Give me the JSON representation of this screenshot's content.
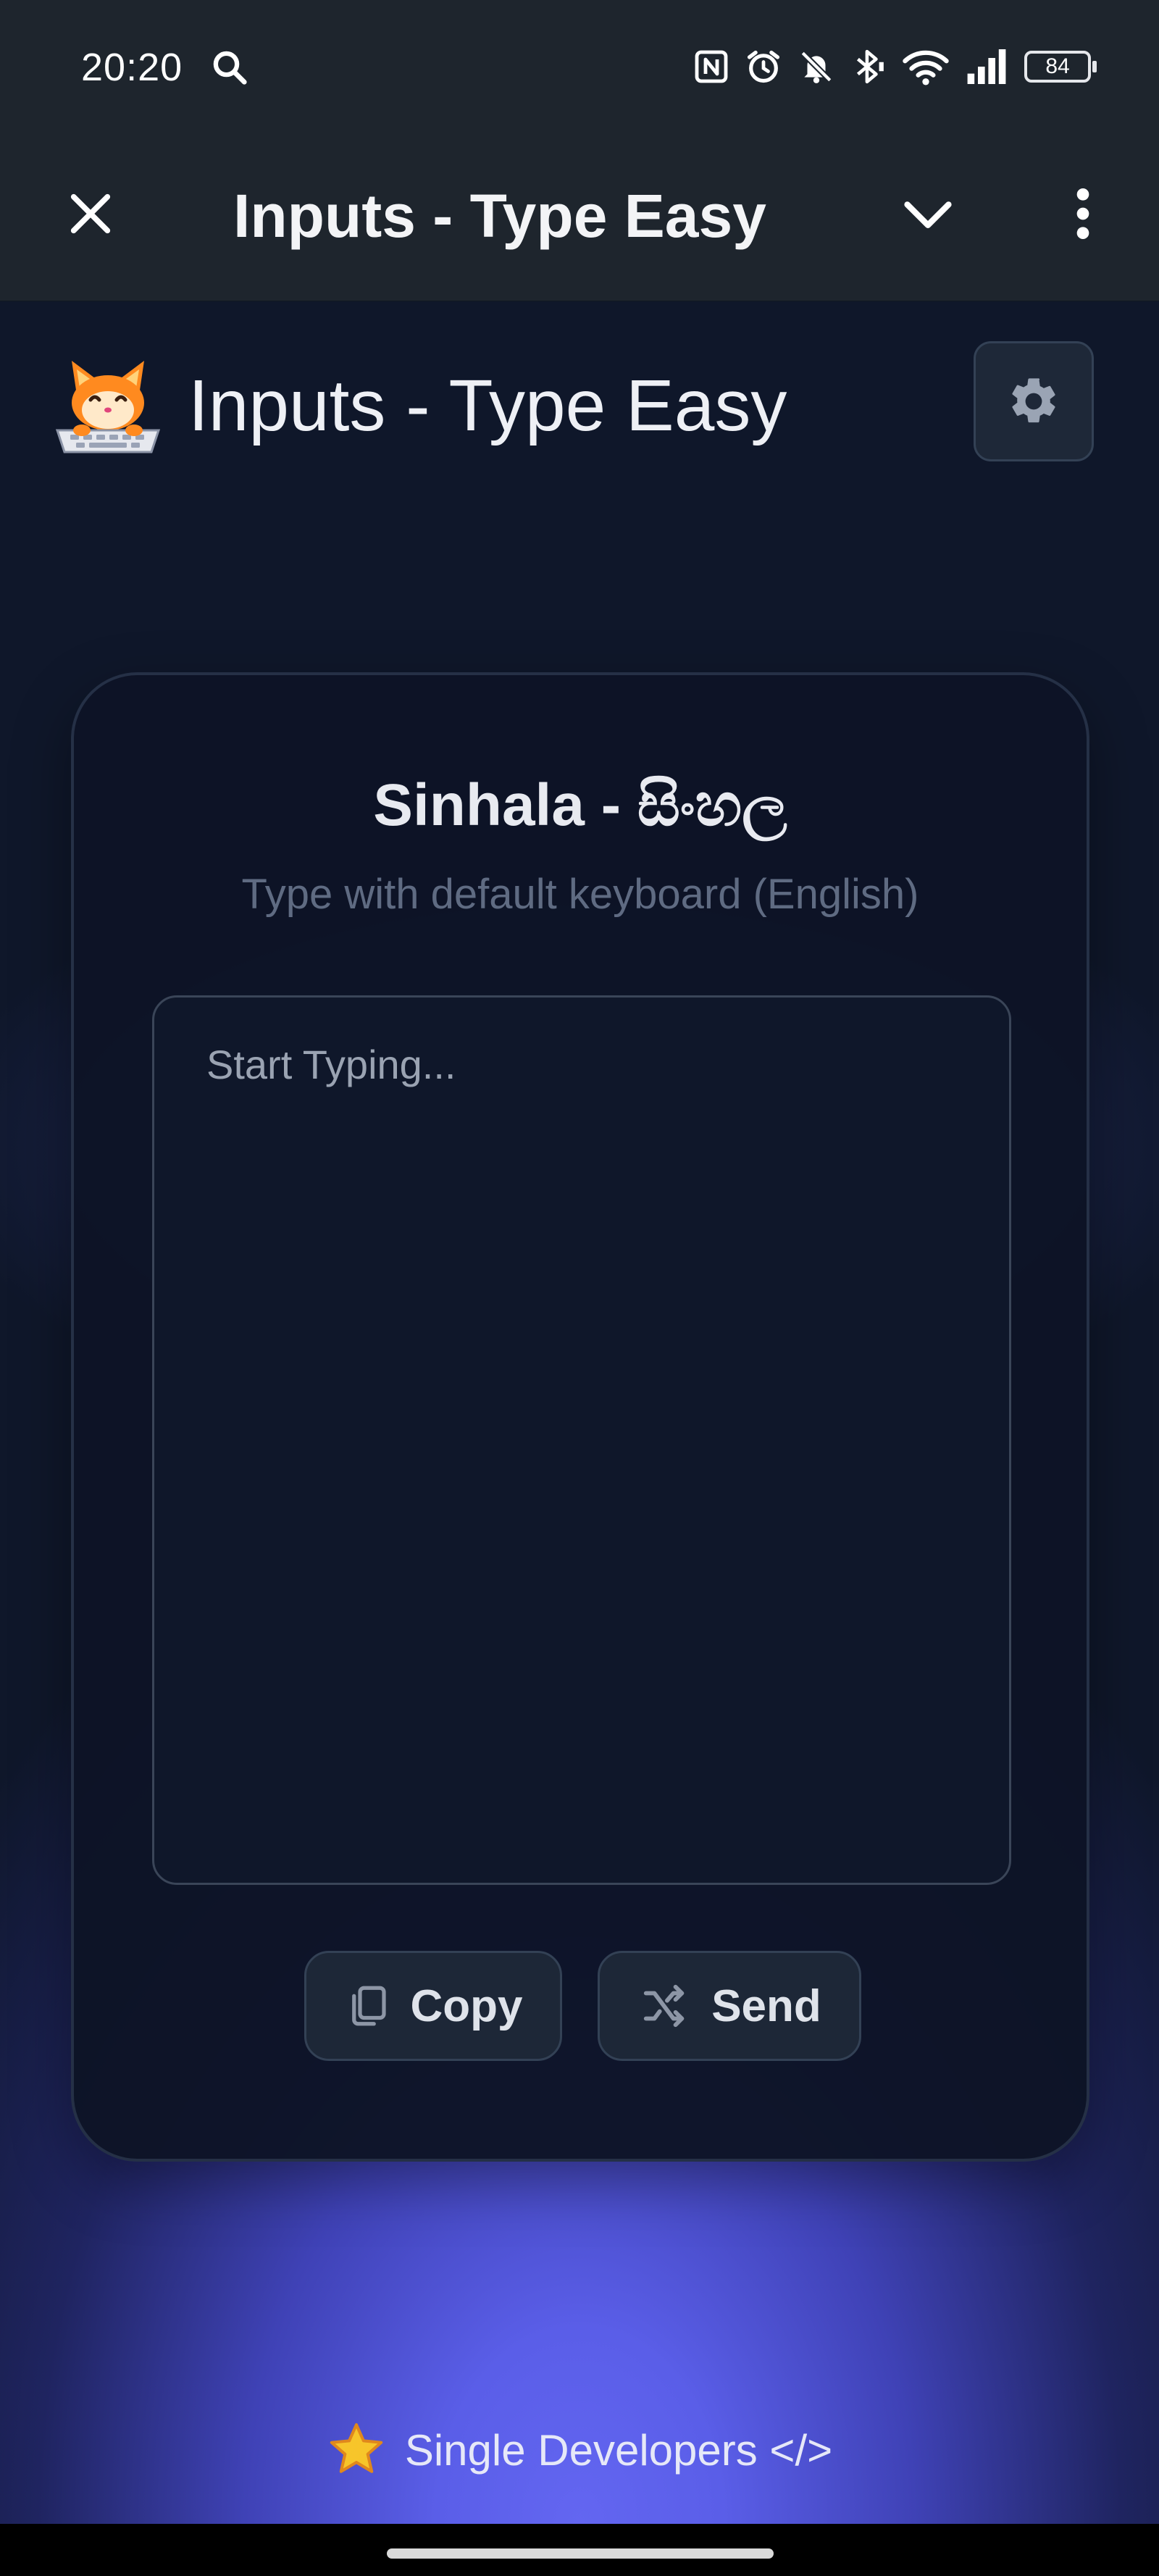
{
  "status_bar": {
    "time": "20:20",
    "battery": "84",
    "icons": [
      "search-icon",
      "nfc-icon",
      "alarm-icon",
      "bell-off-icon",
      "bluetooth-icon",
      "wifi-icon",
      "signal-icon",
      "battery-icon"
    ]
  },
  "toolbar": {
    "title": "Inputs - Type Easy",
    "icons": [
      "close-icon",
      "chevron-down-icon",
      "more-vert-icon"
    ]
  },
  "app": {
    "title": "Inputs - Type Easy",
    "logo_icon": "cat-keyboard-logo",
    "settings_icon": "gear-icon"
  },
  "card": {
    "title": "Sinhala - සිංහල",
    "subtitle": "Type with default keyboard (English)",
    "input_value": "",
    "input_placeholder": "Start Typing...",
    "copy_label": "Copy",
    "send_label": "Send"
  },
  "footer": {
    "text": "Single Developers </>",
    "icon": "star-icon"
  },
  "colors": {
    "background": "#0f172a",
    "card": "#0d1426",
    "accent_glow": "#6366f1",
    "button": "#1d2737",
    "star": "#f5c518"
  }
}
